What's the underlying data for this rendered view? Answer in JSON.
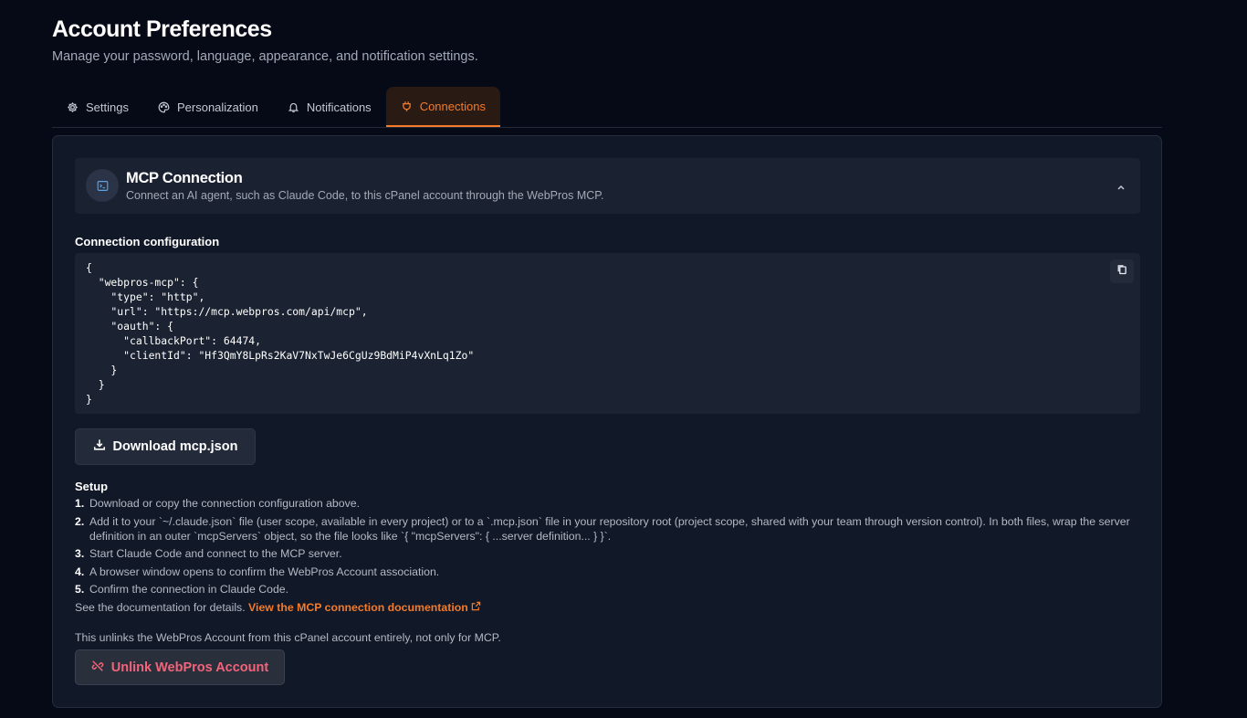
{
  "page": {
    "title": "Account Preferences",
    "subtitle": "Manage your password, language, appearance, and notification settings."
  },
  "tabs": [
    {
      "label": "Settings",
      "icon": "gear-icon",
      "active": false
    },
    {
      "label": "Personalization",
      "icon": "palette-icon",
      "active": false
    },
    {
      "label": "Notifications",
      "icon": "bell-icon",
      "active": false
    },
    {
      "label": "Connections",
      "icon": "plug-icon",
      "active": true
    }
  ],
  "mcp": {
    "title": "MCP Connection",
    "description": "Connect an AI agent, such as Claude Code, to this cPanel account through the WebPros MCP.",
    "icon": "terminal-icon",
    "collapse_icon": "chevron-up-icon"
  },
  "config": {
    "label": "Connection configuration",
    "code": "{\n  \"webpros-mcp\": {\n    \"type\": \"http\",\n    \"url\": \"https://mcp.webpros.com/api/mcp\",\n    \"oauth\": {\n      \"callbackPort\": 64474,\n      \"clientId\": \"Hf3QmY8LpRs2KaV7NxTwJe6CgUz9BdMiP4vXnLq1Zo\"\n    }\n  }\n}",
    "copy_icon": "copy-icon"
  },
  "download": {
    "label": "Download mcp.json",
    "icon": "download-icon"
  },
  "setup": {
    "title": "Setup",
    "steps": [
      {
        "num": "1.",
        "text": "Download or copy the connection configuration above."
      },
      {
        "num": "2.",
        "text": "Add it to your `~/.claude.json` file (user scope, available in every project) or to a `.mcp.json` file in your repository root (project scope, shared with your team through version control). In both files, wrap the server definition in an outer `mcpServers` object, so the file looks like `{ \"mcpServers\": { ...server definition... } }`."
      },
      {
        "num": "3.",
        "text": "Start Claude Code and connect to the MCP server."
      },
      {
        "num": "4.",
        "text": "A browser window opens to confirm the WebPros Account association."
      },
      {
        "num": "5.",
        "text": "Confirm the connection in Claude Code."
      }
    ],
    "doc_prefix": "See the documentation for details.",
    "doc_link": "View the MCP connection documentation",
    "doc_link_icon": "external-link-icon"
  },
  "unlink": {
    "note": "This unlinks the WebPros Account from this cPanel account entirely, not only for MCP.",
    "label": "Unlink WebPros Account",
    "icon": "unlink-icon"
  },
  "colors": {
    "accent": "#f47b2a",
    "danger": "#f2647a",
    "background": "#060a17",
    "card": "#111827"
  }
}
